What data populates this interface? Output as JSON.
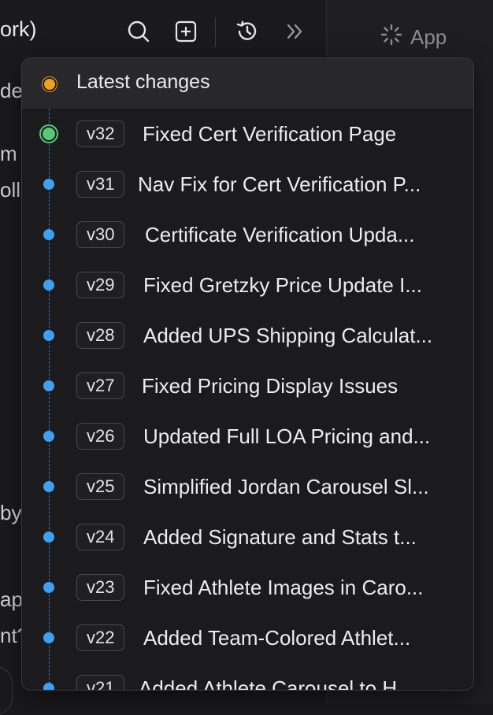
{
  "colors": {
    "background": "#1a1a1c",
    "panel": "#1b1b1d",
    "latest_dot": "#f0a020",
    "current_dot": "#58c878",
    "version_dot": "#3ea0f0"
  },
  "header": {
    "left_title_fragment": "ork)",
    "icons": [
      "search-icon",
      "new-file-icon",
      "history-icon",
      "chevron-double-right-icon"
    ]
  },
  "right_pane": {
    "app_label": "App",
    "icon": "loading-spinner-icon"
  },
  "background_fragments": [
    "de",
    "m",
    "oll",
    "by.:",
    "ap",
    "nt?"
  ],
  "history": {
    "latest_label": "Latest changes",
    "versions": [
      {
        "version": "v32",
        "title": "Fixed Cert Verification Page",
        "current": true
      },
      {
        "version": "v31",
        "title": "Nav Fix for Cert Verification P...",
        "current": false
      },
      {
        "version": "v30",
        "title": "Certificate Verification Upda...",
        "current": false
      },
      {
        "version": "v29",
        "title": "Fixed Gretzky Price Update I...",
        "current": false
      },
      {
        "version": "v28",
        "title": "Added UPS Shipping Calculat...",
        "current": false
      },
      {
        "version": "v27",
        "title": "Fixed Pricing Display Issues",
        "current": false
      },
      {
        "version": "v26",
        "title": "Updated Full LOA Pricing and...",
        "current": false
      },
      {
        "version": "v25",
        "title": "Simplified Jordan Carousel Sl...",
        "current": false
      },
      {
        "version": "v24",
        "title": "Added Signature and Stats t...",
        "current": false
      },
      {
        "version": "v23",
        "title": "Fixed Athlete Images in Caro...",
        "current": false
      },
      {
        "version": "v22",
        "title": "Added Team-Colored Athlet...",
        "current": false
      },
      {
        "version": "v21",
        "title": "Added Athlete Carousel to H...",
        "current": false
      }
    ]
  }
}
